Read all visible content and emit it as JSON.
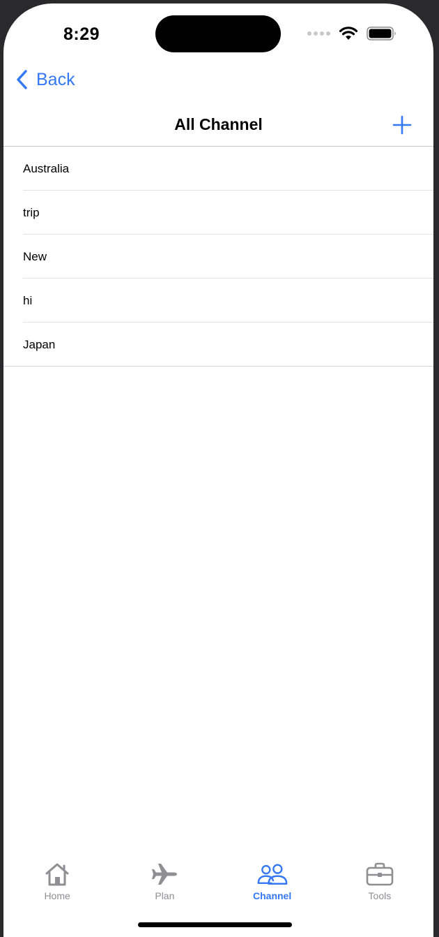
{
  "status_bar": {
    "time": "8:29"
  },
  "nav": {
    "back_label": "Back",
    "title": "All Channel",
    "add_icon": "plus-icon"
  },
  "channels": [
    "Australia",
    "trip",
    "New",
    "hi",
    "Japan"
  ],
  "tabs": [
    {
      "label": "Home",
      "icon": "house-icon",
      "active": false
    },
    {
      "label": "Plan",
      "icon": "airplane-icon",
      "active": false
    },
    {
      "label": "Channel",
      "icon": "people-icon",
      "active": true
    },
    {
      "label": "Tools",
      "icon": "briefcase-icon",
      "active": false
    }
  ],
  "colors": {
    "accent": "#3478f6",
    "inactive": "#8e8e93",
    "separator": "#e2e2e5"
  }
}
